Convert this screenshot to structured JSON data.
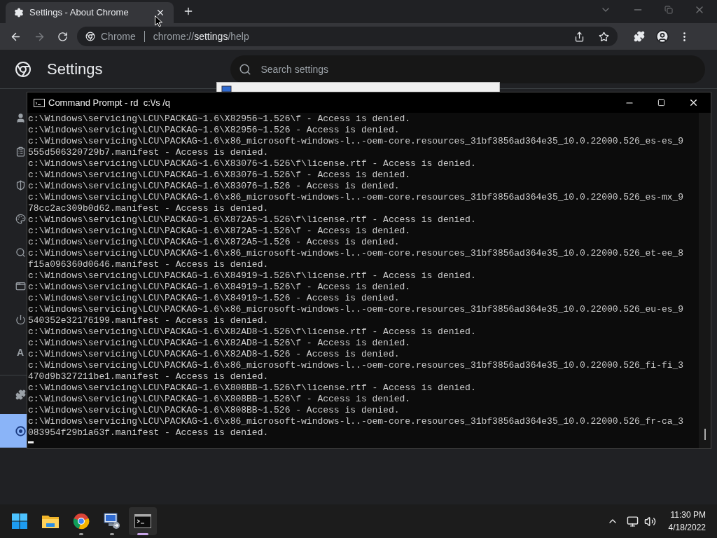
{
  "browser": {
    "tabs": [
      {
        "title": "Settings - About Chrome",
        "selected": true
      }
    ],
    "address": {
      "site_label": "Chrome",
      "url_scheme": "chrome://",
      "url_host": "settings",
      "url_path": "/help"
    }
  },
  "settings": {
    "title": "Settings",
    "search": {
      "placeholder": "Search settings"
    },
    "sidebar": {
      "items": [
        {
          "kind": "icon",
          "selected": false
        },
        {
          "kind": "icon",
          "selected": false
        },
        {
          "kind": "icon",
          "selected": false
        },
        {
          "kind": "icon",
          "selected": false
        },
        {
          "kind": "icon",
          "selected": false
        },
        {
          "kind": "icon",
          "selected": false
        },
        {
          "kind": "icon",
          "selected": false
        },
        {
          "kind": "text",
          "label": "A",
          "selected": false
        },
        {
          "kind": "icon",
          "selected": false
        },
        {
          "kind": "icon",
          "selected": true
        }
      ]
    }
  },
  "cmd_window": {
    "title": "Command Prompt - rd  c:\\/s /q",
    "lines": [
      "c:\\Windows\\servicing\\LCU\\PACKAG~1.6\\X82956~1.526\\f - Access is denied.",
      "c:\\Windows\\servicing\\LCU\\PACKAG~1.6\\X82956~1.526 - Access is denied.",
      "c:\\Windows\\servicing\\LCU\\PACKAG~1.6\\x86_microsoft-windows-l..-oem-core.resources_31bf3856ad364e35_10.0.22000.526_es-es_9",
      "555d506320729b7.manifest - Access is denied.",
      "c:\\Windows\\servicing\\LCU\\PACKAG~1.6\\X83076~1.526\\f\\license.rtf - Access is denied.",
      "c:\\Windows\\servicing\\LCU\\PACKAG~1.6\\X83076~1.526\\f - Access is denied.",
      "c:\\Windows\\servicing\\LCU\\PACKAG~1.6\\X83076~1.526 - Access is denied.",
      "c:\\Windows\\servicing\\LCU\\PACKAG~1.6\\x86_microsoft-windows-l..-oem-core.resources_31bf3856ad364e35_10.0.22000.526_es-mx_9",
      "78cc2ac309b0d62.manifest - Access is denied.",
      "c:\\Windows\\servicing\\LCU\\PACKAG~1.6\\X872A5~1.526\\f\\license.rtf - Access is denied.",
      "c:\\Windows\\servicing\\LCU\\PACKAG~1.6\\X872A5~1.526\\f - Access is denied.",
      "c:\\Windows\\servicing\\LCU\\PACKAG~1.6\\X872A5~1.526 - Access is denied.",
      "c:\\Windows\\servicing\\LCU\\PACKAG~1.6\\x86_microsoft-windows-l..-oem-core.resources_31bf3856ad364e35_10.0.22000.526_et-ee_8",
      "f15a096360d0646.manifest - Access is denied.",
      "c:\\Windows\\servicing\\LCU\\PACKAG~1.6\\X84919~1.526\\f\\license.rtf - Access is denied.",
      "c:\\Windows\\servicing\\LCU\\PACKAG~1.6\\X84919~1.526\\f - Access is denied.",
      "c:\\Windows\\servicing\\LCU\\PACKAG~1.6\\X84919~1.526 - Access is denied.",
      "c:\\Windows\\servicing\\LCU\\PACKAG~1.6\\x86_microsoft-windows-l..-oem-core.resources_31bf3856ad364e35_10.0.22000.526_eu-es_9",
      "540352e32176199.manifest - Access is denied.",
      "c:\\Windows\\servicing\\LCU\\PACKAG~1.6\\X82AD8~1.526\\f\\license.rtf - Access is denied.",
      "c:\\Windows\\servicing\\LCU\\PACKAG~1.6\\X82AD8~1.526\\f - Access is denied.",
      "c:\\Windows\\servicing\\LCU\\PACKAG~1.6\\X82AD8~1.526 - Access is denied.",
      "c:\\Windows\\servicing\\LCU\\PACKAG~1.6\\x86_microsoft-windows-l..-oem-core.resources_31bf3856ad364e35_10.0.22000.526_fi-fi_3",
      "470d9b327211be1.manifest - Access is denied.",
      "c:\\Windows\\servicing\\LCU\\PACKAG~1.6\\X808BB~1.526\\f\\license.rtf - Access is denied.",
      "c:\\Windows\\servicing\\LCU\\PACKAG~1.6\\X808BB~1.526\\f - Access is denied.",
      "c:\\Windows\\servicing\\LCU\\PACKAG~1.6\\X808BB~1.526 - Access is denied.",
      "c:\\Windows\\servicing\\LCU\\PACKAG~1.6\\x86_microsoft-windows-l..-oem-core.resources_31bf3856ad364e35_10.0.22000.526_fr-ca_3",
      "083954f29b1a63f.manifest - Access is denied."
    ]
  },
  "taskbar": {
    "apps": [
      {
        "kind": "start",
        "running": false,
        "active": false
      },
      {
        "kind": "folder",
        "running": false,
        "active": false
      },
      {
        "kind": "browser",
        "running": true,
        "active": false
      },
      {
        "kind": "remote",
        "running": true,
        "active": false
      },
      {
        "kind": "terminal",
        "running": true,
        "active": true
      }
    ],
    "clock": {
      "time": "11:30 PM",
      "date": "4/18/2022"
    }
  }
}
